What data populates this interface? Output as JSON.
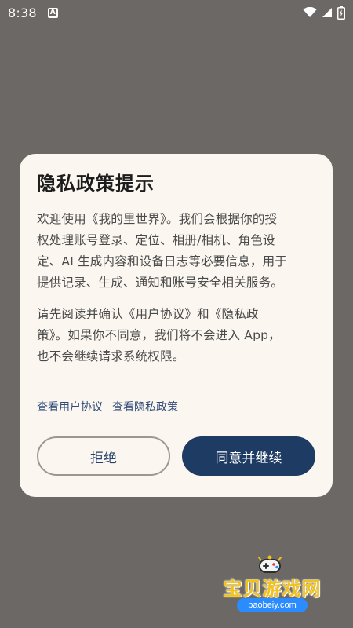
{
  "status_bar": {
    "time": "8:38",
    "notification_badge": "A",
    "icons": [
      "wifi-icon",
      "signal-icon",
      "battery-icon"
    ]
  },
  "dialog": {
    "title": "隐私政策提示",
    "paragraph_1_lines": [
      "欢迎使用《我的里世界》。我们会根据你的授",
      "权处理账号登录、定位、相册/相机、角色设",
      "定、AI 生成内容和设备日志等必要信息，用于",
      "提供记录、生成、通知和账号安全相关服务。"
    ],
    "paragraph_2_lines": [
      "请先阅读并确认《用户协议》和《隐私政",
      "策》。如果你不同意，我们将不会进入 App，",
      "也不会继续请求系统权限。"
    ],
    "links": {
      "user_agreement": "查看用户协议",
      "privacy_policy": "查看隐私政策"
    },
    "buttons": {
      "reject": "拒绝",
      "accept": "同意并继续"
    }
  },
  "watermark": {
    "name": "宝贝游戏网",
    "domain": "baobeiy.com"
  },
  "colors": {
    "backdrop": "#6b6865",
    "dialog_bg": "#fbf7f0",
    "primary": "#1e3b63",
    "link": "#2f4a78",
    "watermark": "#f2c21b",
    "watermark_domain_bg": "#2a8cff"
  }
}
